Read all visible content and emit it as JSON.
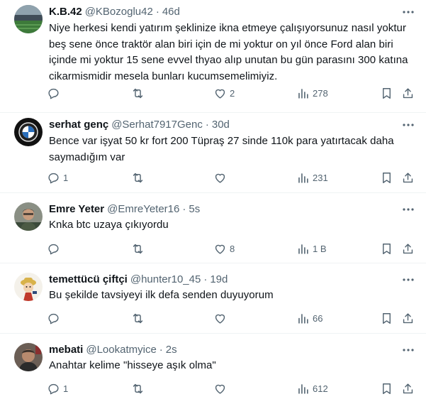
{
  "tweets": [
    {
      "name": "K.B.42",
      "handle": "@KBozoglu42",
      "time": "46d",
      "text": "Niye herkesi kendi yatırım şeklinize ikna etmeye çalışıyorsunuz nasıl yoktur beş sene önce traktör alan biri için de mi yoktur on yıl önce Ford alan biri içinde mi yoktur 15 sene evvel thyao alıp unutan bu gün parasını 300 katına cikarmismidir mesela bunları kucumsemelimiyiz.",
      "replies": "",
      "retweets": "",
      "likes": "2",
      "views": "278",
      "avatar": "stadium"
    },
    {
      "name": "serhat genç",
      "handle": "@Serhat7917Genc",
      "time": "30d",
      "text": "Bence var işyat 50 kr fort 200 Tüpraş 27 sinde 110k para yatırtacak daha saymadığım var",
      "replies": "1",
      "retweets": "",
      "likes": "",
      "views": "231",
      "avatar": "bmw-logo"
    },
    {
      "name": "Emre Yeter",
      "handle": "@EmreYeter16",
      "time": "5s",
      "text": "Knka btc uzaya çıkıyordu",
      "replies": "",
      "retweets": "",
      "likes": "8",
      "views": "1 B",
      "avatar": "man-photo"
    },
    {
      "name": "temettücü çiftçi",
      "handle": "@hunter10_45",
      "time": "19d",
      "text": "Bu şekilde tavsiyeyi ilk defa senden duyuyorum",
      "replies": "",
      "retweets": "",
      "likes": "",
      "views": "66",
      "avatar": "cartoon-character"
    },
    {
      "name": "mebati",
      "handle": "@Lookatmyice",
      "time": "2s",
      "text": "Anahtar kelime \"hisseye aşık olma\"",
      "replies": "1",
      "retweets": "",
      "likes": "",
      "views": "612",
      "avatar": "man-photo"
    }
  ],
  "separator": "·",
  "colors": {
    "text": "#0f1419",
    "secondary": "#536471",
    "border": "#eff3f4"
  }
}
